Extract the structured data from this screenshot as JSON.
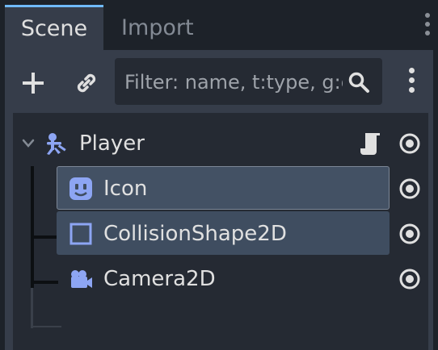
{
  "tabs": [
    {
      "label": "Scene",
      "active": true
    },
    {
      "label": "Import",
      "active": false
    }
  ],
  "toolbar": {
    "add_icon": "plus-icon",
    "link_icon": "link-icon",
    "filter_placeholder": "Filter: name, t:type, g:group",
    "search_icon": "search-icon",
    "menu_icon": "kebab-menu-icon"
  },
  "tree": {
    "nodes": [
      {
        "name": "Player",
        "icon": "character-body-icon",
        "expanded": true,
        "has_script": true,
        "visible": true
      },
      {
        "name": "Icon",
        "icon": "sprite-icon",
        "selected": true,
        "focused": true,
        "visible": true
      },
      {
        "name": "CollisionShape2D",
        "icon": "collision-shape-icon",
        "selected": true,
        "visible": true
      },
      {
        "name": "Camera2D",
        "icon": "camera-icon",
        "selected": false,
        "visible": true
      }
    ]
  },
  "colors": {
    "accent": "#70bafa",
    "node_2d_icon": "#8da5f3",
    "selection": "#3f4d60"
  }
}
